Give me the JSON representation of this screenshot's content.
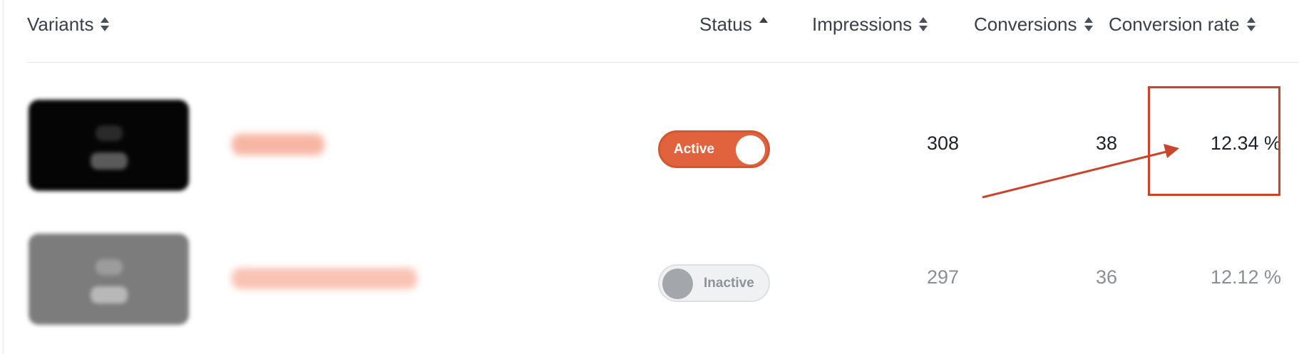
{
  "header": {
    "variants": "Variants",
    "status": "Status",
    "impressions": "Impressions",
    "conversions": "Conversions",
    "conversion_rate": "Conversion rate"
  },
  "rows": [
    {
      "status_label": "Active",
      "status_on": true,
      "impressions": "308",
      "conversions": "38",
      "conversion_rate": "12.34 %"
    },
    {
      "status_label": "Inactive",
      "status_on": false,
      "impressions": "297",
      "conversions": "36",
      "conversion_rate": "12.12 %"
    }
  ],
  "colors": {
    "accent": "#e0633e",
    "annotation": "#c8452b",
    "inactive_knob": "#a3a6ab"
  },
  "icons": {
    "sort": "sort-up-down-icon",
    "sort_asc": "sort-asc-icon"
  }
}
